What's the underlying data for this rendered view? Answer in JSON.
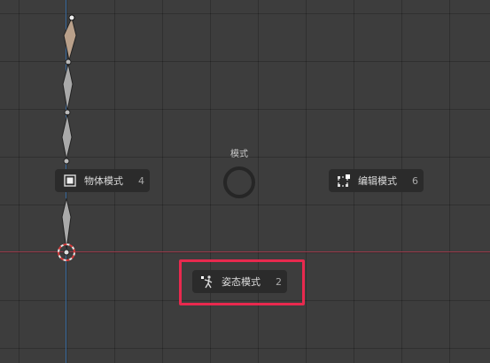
{
  "pie_menu": {
    "title": "模式",
    "items": [
      {
        "label": "物体模式",
        "key": "4",
        "icon": "object-mode-icon"
      },
      {
        "label": "编辑模式",
        "key": "6",
        "icon": "edit-mode-icon"
      },
      {
        "label": "姿态模式",
        "key": "2",
        "icon": "pose-mode-icon"
      }
    ]
  },
  "colors": {
    "background": "#3d3d3d",
    "x_axis": "#9a3a4a",
    "y_axis": "#3a6a9e",
    "highlight": "#e8294e",
    "menu_item_bg": "#2b2b2b"
  }
}
